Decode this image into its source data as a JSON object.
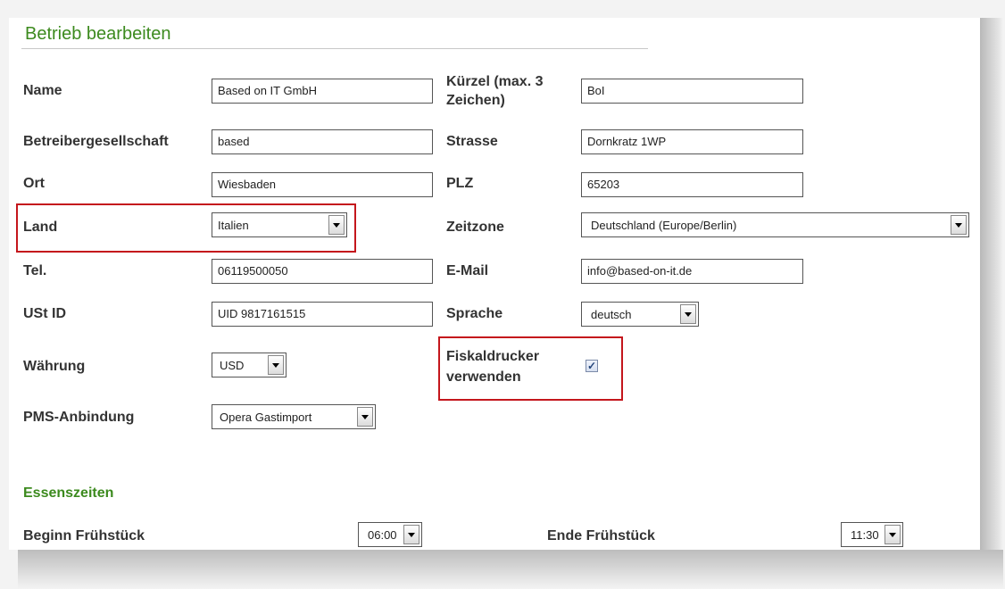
{
  "form": {
    "title": "Betrieb bearbeiten",
    "labels": {
      "name": "Name",
      "kuerzel_line1": "Kürzel (max. 3",
      "kuerzel_line2": "Zeichen)",
      "betreiber": "Betreibergesellschaft",
      "strasse": "Strasse",
      "ort": "Ort",
      "plz": "PLZ",
      "land": "Land",
      "zeitzone": "Zeitzone",
      "tel": "Tel.",
      "email": "E-Mail",
      "ustid": "USt ID",
      "sprache": "Sprache",
      "waehrung": "Währung",
      "fiskal_line1": "Fiskaldrucker",
      "fiskal_line2": "verwenden",
      "pms": "PMS-Anbindung"
    },
    "values": {
      "name": "Based on IT GmbH",
      "kuerzel": "BoI",
      "betreiber": "based",
      "strasse": "Dornkratz 1WP",
      "ort": "Wiesbaden",
      "plz": "65203",
      "land": "Italien",
      "zeitzone": "Deutschland (Europe/Berlin)",
      "tel": "06119500050",
      "email": "info@based-on-it.de",
      "ustid": "UID 9817161515",
      "sprache": "deutsch",
      "waehrung": "USD",
      "fiskaldrucker_checked": true,
      "pms": "Opera Gastimport"
    }
  },
  "essenszeiten": {
    "title": "Essenszeiten",
    "beginn_label": "Beginn Frühstück",
    "beginn_value": "06:00",
    "ende_label": "Ende Frühstück",
    "ende_value": "11:30"
  },
  "icons": {
    "dropdown": "chevron-down-icon",
    "check": "checkmark-icon"
  },
  "colors": {
    "title_green": "#3c8a1e",
    "highlight_red": "#c4161c"
  }
}
